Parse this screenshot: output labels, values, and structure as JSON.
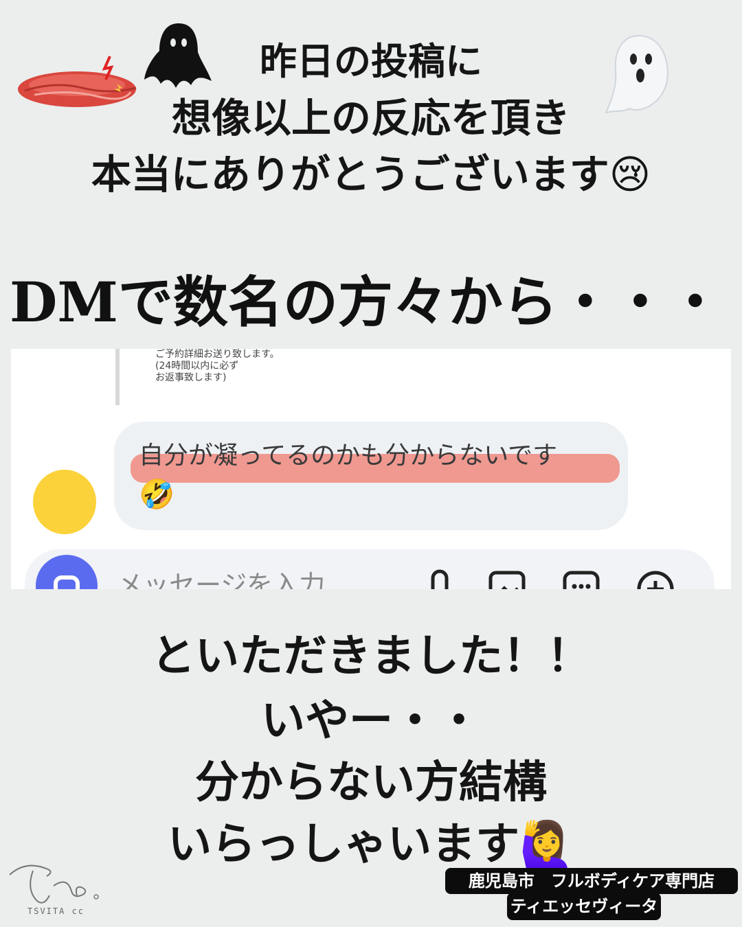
{
  "header": {
    "line1": "昨日の投稿に",
    "line2": "想像以上の反応を頂き",
    "line3": "本当にありがとうございます😢"
  },
  "dm_heading": "DMで数名の方々から・・・・",
  "screenshot": {
    "previous_message": "ご予約詳細お送り致します。\n(24時間以内に必ず\nお返事致します)",
    "message_text": "自分が凝ってるのかも分からないです",
    "message_emoji": "🤣",
    "input_placeholder": "メッセージを入力",
    "avatar_color": "#fbd23a",
    "camera_button_color": "#5b6bf0",
    "highlight_color": "#ef8f86",
    "tool_icons": [
      "microphone-icon",
      "image-icon",
      "sticker-icon",
      "plus-icon"
    ]
  },
  "body": {
    "line1": "といただきました！！",
    "line2": "いやー・・",
    "line3": "分からない方結構",
    "line4": "いらっしゃいます🙋‍♀️"
  },
  "branding": {
    "logo_sub": "TSVITA cc",
    "tag1": "鹿児島市　フルボディケア専門店",
    "tag2": "ティエッセヴィータ"
  },
  "colors": {
    "background": "#ebeeed",
    "text": "#151515",
    "tag_background": "#0c0c0c"
  }
}
